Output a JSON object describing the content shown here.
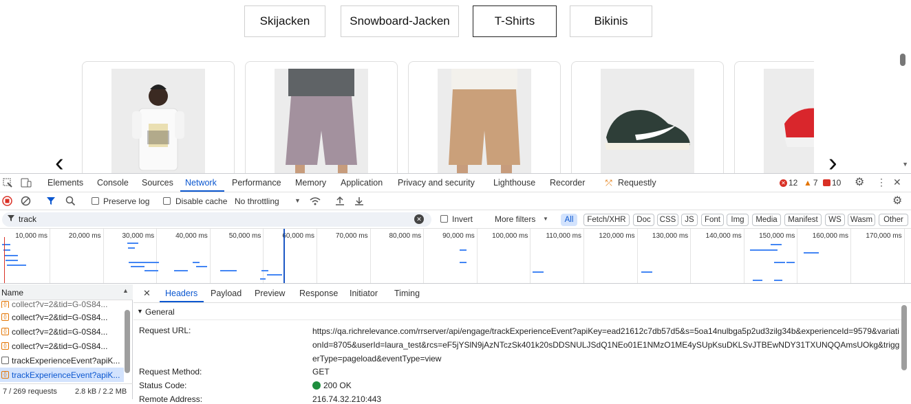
{
  "page": {
    "categories": [
      "Skijacken",
      "Snowboard-Jacken",
      "T-Shirts",
      "Bikinis"
    ],
    "prev_arrow": "‹",
    "next_arrow": "›"
  },
  "devtools": {
    "tabs": [
      "Elements",
      "Console",
      "Sources",
      "Network",
      "Performance",
      "Memory",
      "Application",
      "Privacy and security",
      "Lighthouse",
      "Recorder",
      "Requestly"
    ],
    "active_tab": "Network",
    "errors": "12",
    "warnings": "7",
    "issues": "10",
    "toolbar": {
      "preserve_log": "Preserve log",
      "disable_cache": "Disable cache",
      "throttling": "No throttling"
    },
    "filter": {
      "value": "track",
      "invert": "Invert",
      "more_filters": "More filters",
      "types": [
        "All",
        "Fetch/XHR",
        "Doc",
        "CSS",
        "JS",
        "Font",
        "Img",
        "Media",
        "Manifest",
        "WS",
        "Wasm",
        "Other"
      ]
    },
    "timeline_ticks": [
      "10,000 ms",
      "20,000 ms",
      "30,000 ms",
      "40,000 ms",
      "50,000 ms",
      "60,000 ms",
      "70,000 ms",
      "80,000 ms",
      "90,000 ms",
      "100,000 ms",
      "110,000 ms",
      "120,000 ms",
      "130,000 ms",
      "140,000 ms",
      "150,000 ms",
      "160,000 ms",
      "170,000 ms"
    ],
    "requests": {
      "column": "Name",
      "rows": [
        {
          "name": "collect?v=2&tid=G-0S84...",
          "type": "xhr"
        },
        {
          "name": "collect?v=2&tid=G-0S84...",
          "type": "xhr"
        },
        {
          "name": "collect?v=2&tid=G-0S84...",
          "type": "xhr"
        },
        {
          "name": "trackExperienceEvent?apiK...",
          "type": "doc"
        },
        {
          "name": "trackExperienceEvent?apiK...",
          "type": "xhr"
        }
      ],
      "summary_count": "7 / 269 requests",
      "summary_size": "2.8 kB / 2.2 MB"
    },
    "detail": {
      "tabs": [
        "Headers",
        "Payload",
        "Preview",
        "Response",
        "Initiator",
        "Timing"
      ],
      "active": "Headers",
      "section": "General",
      "request_url_label": "Request URL:",
      "request_url": "https://qa.richrelevance.com/rrserver/api/engage/trackExperienceEvent?apiKey=ead21612c7db57d5&s=5oa14nulbga5p2ud3zilg34b&experienceId=9579&variationId=8705&userId=laura_test&rcs=eF5jYSlN9jAzNTczSk401k20sDDSNULJSdQ1NEo01E1NMzO1ME4ySUpKsuDKLSvJTBEwNDY31TXUNQQAmsUOkg&triggerType=pageload&eventType=view",
      "method_label": "Request Method:",
      "method": "GET",
      "status_label": "Status Code:",
      "status": "200 OK",
      "remote_label": "Remote Address:",
      "remote": "216.74.32.210:443"
    }
  }
}
